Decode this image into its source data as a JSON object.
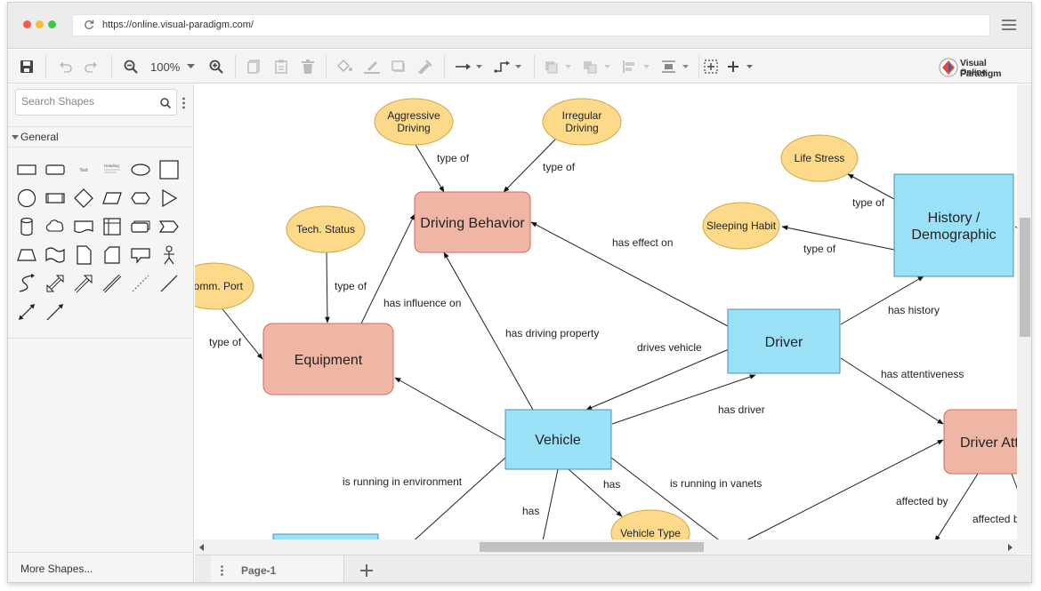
{
  "browser": {
    "url": "https://online.visual-paradigm.com/",
    "colors": {
      "close": "#f25b55",
      "minimize": "#f5bd2f",
      "maximize": "#3fc84a"
    }
  },
  "toolbar": {
    "zoom": "100%",
    "buttons": [
      "save-icon",
      "undo-icon",
      "redo-icon",
      "zoom-out-icon",
      "zoom-in-icon",
      "copy-icon",
      "paste-icon",
      "delete-icon",
      "fill-icon",
      "line-color-icon",
      "shadow-icon",
      "format-painter-icon",
      "connector-icon",
      "waypoint-icon",
      "arrange-icon",
      "group-icon",
      "align-icon",
      "distribute-icon",
      "select-area-icon",
      "add-icon"
    ],
    "logo": {
      "line1": "Visual Paradigm",
      "line2": "Online"
    }
  },
  "sidebar": {
    "search_placeholder": "Search Shapes",
    "section": "General",
    "palette_text_item": "Text",
    "palette_heading_item": "Heading",
    "more_shapes": "More Shapes..."
  },
  "pagebar": {
    "page_name": "Page-1"
  },
  "diagram": {
    "nodes": {
      "aggressive": "Aggressive\nDriving",
      "irregular": "Irregular\nDriving",
      "life_stress": "Life Stress",
      "sleeping_habit": "Sleeping Habit",
      "history": "History /\nDemographic",
      "tech_status": "Tech. Status",
      "comm_port": "Comm. Port",
      "driving_behavior": "Driving Behavior",
      "equipment": "Equipment",
      "driver": "Driver",
      "vehicle": "Vehicle",
      "driver_attention": "Driver Attention",
      "vehicle_type": "Vehicle Type"
    },
    "edge_labels": {
      "type_of_1": "type of",
      "type_of_2": "type of",
      "type_of_3": "type of",
      "type_of_4": "type of",
      "type_of_5": "type of",
      "type_of_6": "type of",
      "has_effect_on": "has effect on",
      "has_influence_on": "has influence on",
      "has_driving_property": "has driving property",
      "drives_vehicle": "drives vehicle",
      "has_history": "has history",
      "has_attentiveness": "has attentiveness",
      "has_driver": "has driver",
      "is_running_in_environment": "is running in environment",
      "has_1": "has",
      "has_2": "has",
      "is_running_in_vanets": "is running in vanets",
      "affected_by_1": "affected by",
      "affected_by_2": "affected by"
    },
    "colors": {
      "concept_fill": "#9ae0f7",
      "concept_stroke": "#4a8fb4",
      "attr_fill": "#fdd98a",
      "attr_stroke": "#d3a640",
      "process_fill": "#efb6a5",
      "process_stroke": "#d4685a"
    }
  }
}
